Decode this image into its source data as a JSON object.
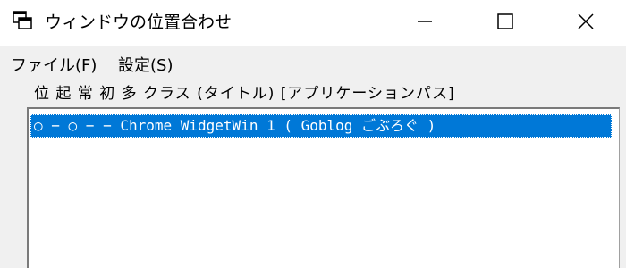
{
  "window": {
    "title": "ウィンドウの位置合わせ",
    "icon": "window-app-icon",
    "controls": {
      "minimize_icon": "minimize-icon",
      "maximize_icon": "maximize-icon",
      "close_icon": "close-icon"
    }
  },
  "menu": {
    "items": [
      {
        "label": "ファイル(F)"
      },
      {
        "label": "設定(S)"
      }
    ]
  },
  "list": {
    "header": "位 起 常 初 多 クラス (タイトル) [アプリケーションパス]",
    "rows": [
      {
        "text": "○ − ○ − − Chrome WidgetWin 1 ( Goblog ごぶろぐ )",
        "selected": true
      }
    ]
  },
  "colors": {
    "selection": "#0078d7",
    "window_bg": "#f0f0f0",
    "titlebar_bg": "#ffffff"
  }
}
